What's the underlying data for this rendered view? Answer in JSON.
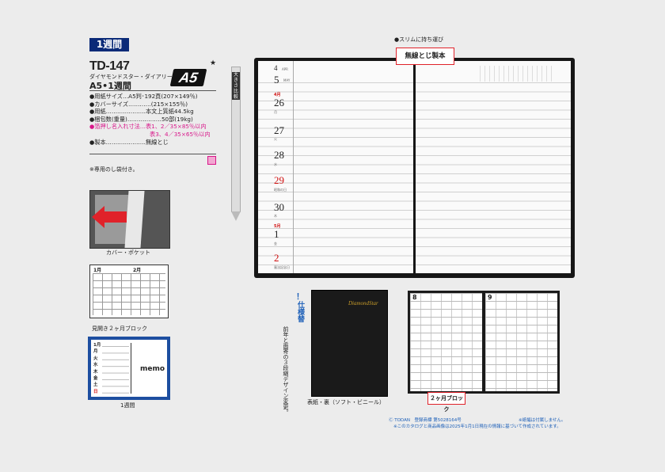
{
  "badge": "1週間",
  "product_code": "TD-147",
  "star": "★",
  "series_name": "ダイヤモンドスター・ダイアリー",
  "subtitle": "A5•1週間",
  "size_badge": "A5",
  "specs": [
    "●用紙サイズ…A5判･192頁(207×149％)",
    "●カバーサイズ…………(215×155％)",
    "●用紙…………………本文上質紙44.5kg",
    "●梱包数(重量)………………50部(19kg)"
  ],
  "spec_pink_1": "●箔押し名入れ寸法…表1、2／35×85％以内",
  "spec_pink_2": "表3、4／35×65％以内",
  "spec_binding": "●製本…………………無線とじ",
  "pink_mark": "M",
  "note": "※専用のし袋付き。",
  "pocket_caption": "カバー・ポケット",
  "two_month": {
    "caption": "見開き２ヶ月ブロック",
    "month1": "1月",
    "month2": "2月"
  },
  "weekly": {
    "caption": "1週間",
    "month": "1月",
    "days": [
      "月",
      "火",
      "水",
      "木",
      "金",
      "土",
      "日"
    ],
    "memo": "memo"
  },
  "pencil_label": "大きさ比較",
  "spread": {
    "top_month": "4",
    "apr": "APR",
    "top_day": "5",
    "may_label": "MAY",
    "month_label_1": "4月",
    "days": [
      "26",
      "27",
      "28",
      "29",
      "30"
    ],
    "sub_labels": [
      "月",
      "火",
      "水",
      "昭和の日",
      "木"
    ],
    "month_label_2": "5月",
    "days2": [
      "1",
      "2"
    ],
    "sub_labels2": [
      "金",
      "憲法記念日"
    ]
  },
  "callout_slim": "●スリムに持ち運び",
  "callout_binding": "無線とじ製本",
  "spec_change": "仕様替",
  "spec_change_mark": "！",
  "spec_desc": "前年と面寄の３段縮デザイン変更。",
  "cover_logo": "DiamondStar",
  "cover_caption": "表紙・裏（ソフト・ビニール）",
  "two_month_spread": {
    "left_month": "8",
    "right_month": "9"
  },
  "callout_2month": "２ヶ月ブロック",
  "footer_copyright": "Ⓒ TODAN　登録商標 第5028164号",
  "footer_note": "※このカタログと商品画像は2025年1月1日現在の情報に基づいて作成されています。",
  "footer_paper": "※紙幅は付属しません。",
  "watermark": "とんこうどう"
}
